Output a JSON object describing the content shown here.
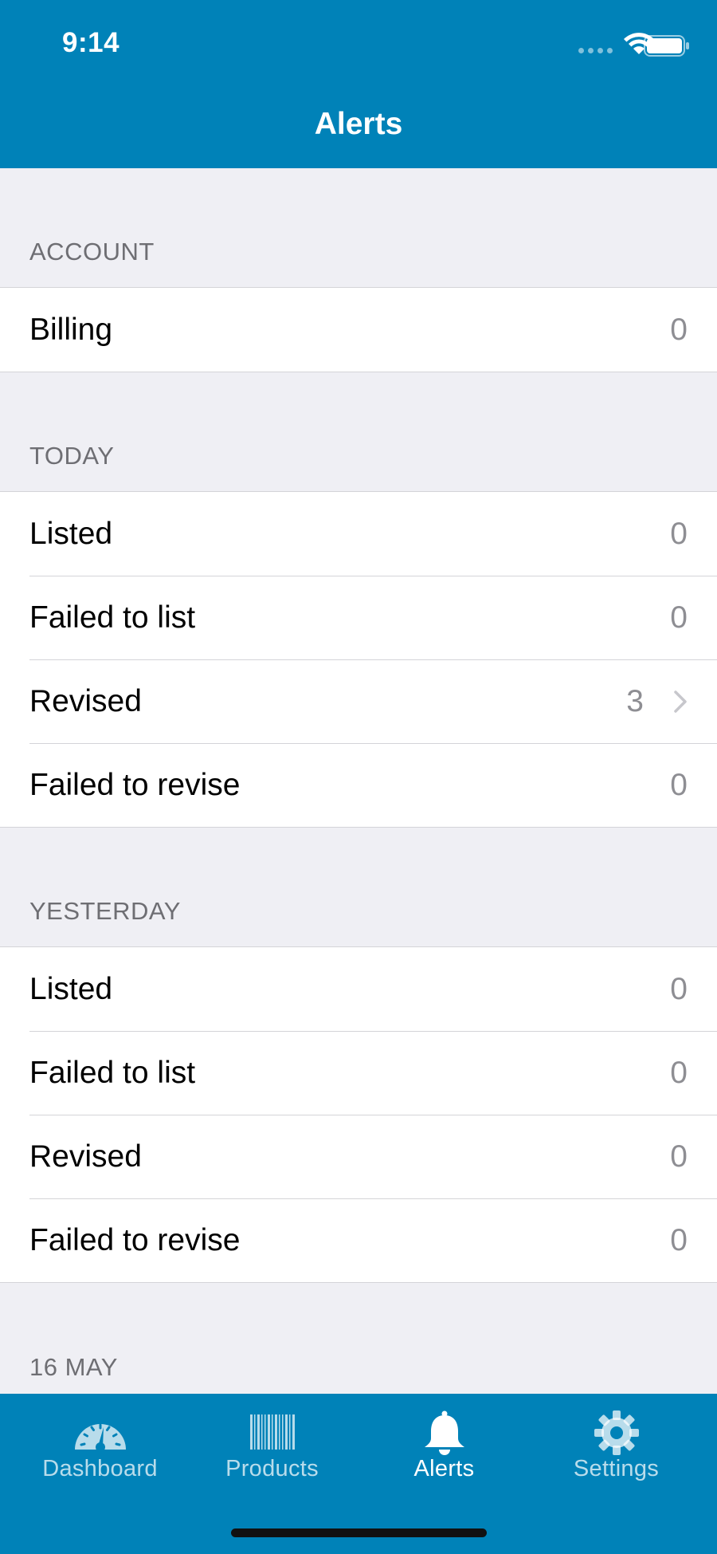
{
  "status_bar": {
    "time": "9:14"
  },
  "nav": {
    "title": "Alerts"
  },
  "sections": {
    "account": {
      "header": "ACCOUNT",
      "rows": [
        {
          "label": "Billing",
          "value": "0"
        }
      ]
    },
    "today": {
      "header": "TODAY",
      "rows": [
        {
          "label": "Listed",
          "value": "0"
        },
        {
          "label": "Failed to list",
          "value": "0"
        },
        {
          "label": "Revised",
          "value": "3"
        },
        {
          "label": "Failed to revise",
          "value": "0"
        }
      ]
    },
    "yesterday": {
      "header": "YESTERDAY",
      "rows": [
        {
          "label": "Listed",
          "value": "0"
        },
        {
          "label": "Failed to list",
          "value": "0"
        },
        {
          "label": "Revised",
          "value": "0"
        },
        {
          "label": "Failed to revise",
          "value": "0"
        }
      ]
    },
    "may16": {
      "header": "16 MAY"
    }
  },
  "tabbar": {
    "tabs": [
      {
        "label": "Dashboard",
        "icon": "dashboard-gauge-icon"
      },
      {
        "label": "Products",
        "icon": "barcode-icon"
      },
      {
        "label": "Alerts",
        "icon": "bell-icon",
        "active": true
      },
      {
        "label": "Settings",
        "icon": "gear-icon"
      }
    ]
  },
  "colors": {
    "brand": "#0082b8",
    "background": "#efeff4",
    "secondary_text": "#8e8e93"
  }
}
